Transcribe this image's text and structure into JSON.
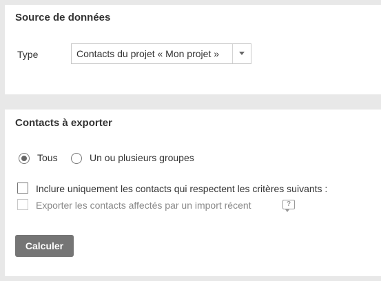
{
  "source_panel": {
    "title": "Source de données",
    "type_label": "Type",
    "type_select": {
      "value": "Contacts du projet « Mon projet »"
    }
  },
  "contacts_panel": {
    "title": "Contacts à exporter",
    "radios": [
      {
        "label": "Tous",
        "checked": true
      },
      {
        "label": "Un ou plusieurs groupes",
        "checked": false
      }
    ],
    "checkboxes": [
      {
        "label": "Inclure uniquement les contacts qui respectent les critères suivants :",
        "checked": false,
        "disabled": false
      },
      {
        "label": "Exporter les contacts affectés par un import récent",
        "checked": false,
        "disabled": true
      }
    ],
    "help_icon": {
      "icon": "help-bubble-icon",
      "glyph": "?"
    },
    "calculate_button": "Calculer"
  },
  "colors": {
    "background": "#e8e8e8",
    "panel": "#ffffff",
    "button": "#757575",
    "text": "#333333",
    "disabled_text": "#888888"
  }
}
